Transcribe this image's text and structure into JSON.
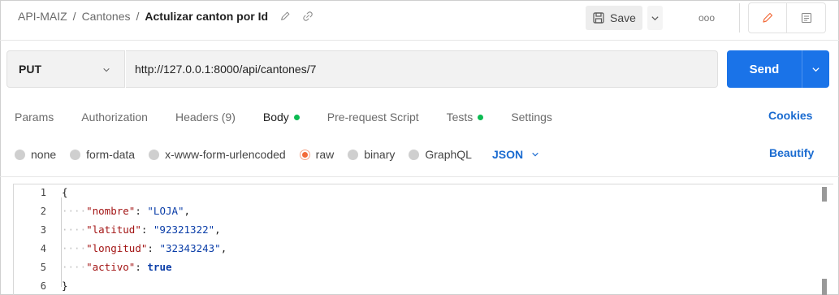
{
  "header": {
    "breadcrumb": [
      "API-MAIZ",
      "Cantones"
    ],
    "separator": "/",
    "current": "Actulizar canton por Id",
    "edit_icon": "pencil-icon",
    "link_icon": "link-icon",
    "save_label": "Save",
    "more_label": "ooo"
  },
  "request": {
    "method": "PUT",
    "url": "http://127.0.0.1:8000/api/cantones/7",
    "send_label": "Send"
  },
  "tabs": [
    {
      "label": "Params",
      "dot": false
    },
    {
      "label": "Authorization",
      "dot": false
    },
    {
      "label": "Headers (9)",
      "dot": false
    },
    {
      "label": "Body",
      "dot": true,
      "active": true
    },
    {
      "label": "Pre-request Script",
      "dot": false
    },
    {
      "label": "Tests",
      "dot": true
    },
    {
      "label": "Settings",
      "dot": false
    }
  ],
  "cookies_label": "Cookies",
  "body_types": [
    {
      "label": "none",
      "checked": false
    },
    {
      "label": "form-data",
      "checked": false
    },
    {
      "label": "x-www-form-urlencoded",
      "checked": false
    },
    {
      "label": "raw",
      "checked": true
    },
    {
      "label": "binary",
      "checked": false
    },
    {
      "label": "GraphQL",
      "checked": false
    }
  ],
  "format_label": "JSON",
  "beautify_label": "Beautify",
  "editor": {
    "line_numbers": [
      "1",
      "2",
      "3",
      "4",
      "5",
      "6"
    ],
    "open_brace": "{",
    "close_brace": "}",
    "indent": "····",
    "fields": [
      {
        "key": "\"nombre\"",
        "value": "\"LOJA\"",
        "type": "string",
        "comma": ","
      },
      {
        "key": "\"latitud\"",
        "value": "\"92321322\"",
        "type": "string",
        "comma": ","
      },
      {
        "key": "\"longitud\"",
        "value": "\"32343243\"",
        "type": "string",
        "comma": ","
      },
      {
        "key": "\"activo\"",
        "value": "true",
        "type": "bool",
        "comma": ""
      }
    ]
  },
  "colors": {
    "accent": "#1a73e8",
    "link": "#1a6bd0",
    "dot_green": "#0cbb52",
    "radio_orange": "#f26b3a",
    "json_key": "#a31515",
    "json_value": "#0b3ea8"
  }
}
